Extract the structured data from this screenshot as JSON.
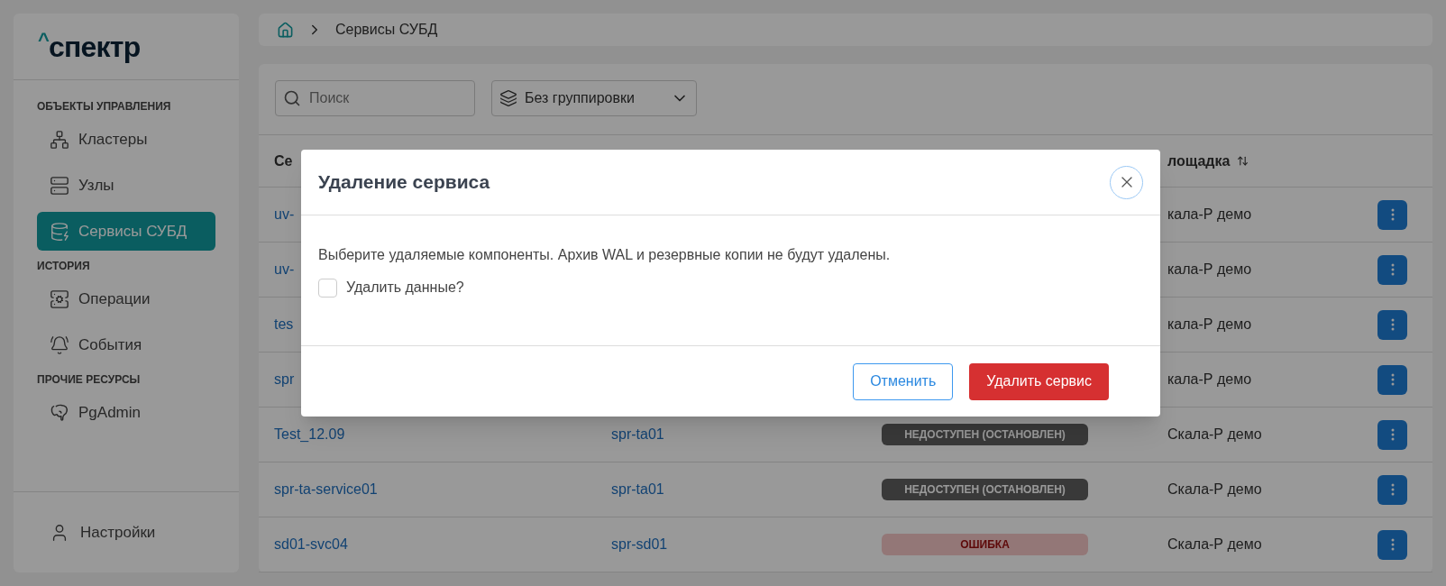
{
  "sidebar": {
    "logo": {
      "mark": "^",
      "text": "спектр"
    },
    "sections": [
      {
        "title": "ОБЪЕКТЫ УПРАВЛЕНИЯ",
        "items": [
          {
            "label": "Кластеры",
            "selected": false
          },
          {
            "label": "Узлы",
            "selected": false
          },
          {
            "label": "Сервисы СУБД",
            "selected": true
          }
        ]
      },
      {
        "title": "ИСТОРИЯ",
        "items": [
          {
            "label": "Операции",
            "selected": false
          },
          {
            "label": "События",
            "selected": false
          }
        ]
      },
      {
        "title": "ПРОЧИЕ РЕСУРСЫ",
        "items": [
          {
            "label": "PgAdmin",
            "selected": false
          }
        ]
      }
    ],
    "footer_item": {
      "label": "Настройки"
    }
  },
  "breadcrumb": {
    "current": "Сервисы СУБД"
  },
  "toolbar": {
    "search": {
      "placeholder": "Поиск"
    },
    "grouping": {
      "value": "Без группировки"
    }
  },
  "table": {
    "columns": {
      "column_1": "Се",
      "site": "лощадка"
    },
    "rows": [
      {
        "name": "uv-",
        "site": "кала-Р демо"
      },
      {
        "name": "uv-",
        "site": "кала-Р демо"
      },
      {
        "name": "tes",
        "site": "кала-Р демо"
      },
      {
        "name": "spr",
        "site": "кала-Р демо"
      },
      {
        "name": "Test_12.09",
        "host": "spr-ta01",
        "status": {
          "kind": "stopped",
          "label": "НЕДОСТУПЕН (ОСТАНОВЛЕН)"
        },
        "site": "Скала-Р демо"
      },
      {
        "name": "spr-ta-service01",
        "host": "spr-ta01",
        "status": {
          "kind": "stopped",
          "label": "НЕДОСТУПЕН (ОСТАНОВЛЕН)"
        },
        "site": "Скала-Р демо"
      },
      {
        "name": "sd01-svc04",
        "host": "spr-sd01",
        "status": {
          "kind": "error",
          "label": "ОШИБКА"
        },
        "site": "Скала-Р демо"
      }
    ]
  },
  "dialog": {
    "title": "Удаление сервиса",
    "message": "Выберите удаляемые компоненты. Архив WAL и резервные копии не будут удалены.",
    "checkbox": {
      "label": "Удалить данные?",
      "checked": false
    },
    "buttons": {
      "cancel": "Отменить",
      "confirm": "Удалить сервис"
    }
  }
}
